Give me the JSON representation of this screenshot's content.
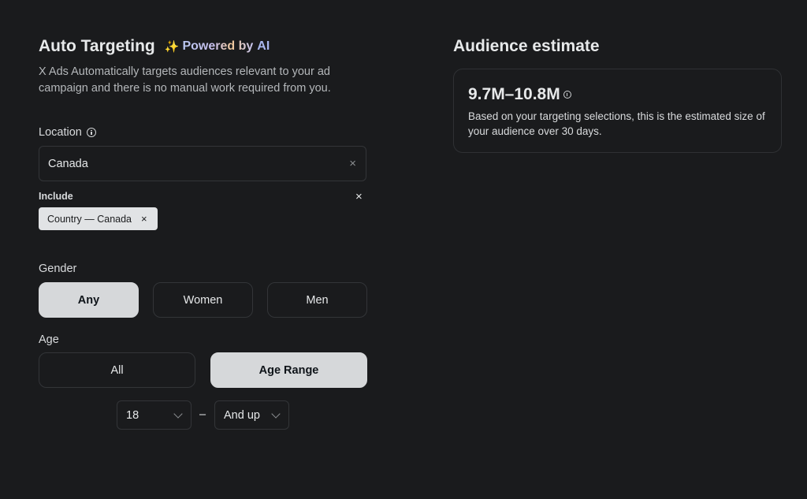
{
  "auto_targeting": {
    "title": "Auto Targeting",
    "powered_sparkle": "✨",
    "powered_by": "Powered by",
    "powered_ai": "AI",
    "description": "X Ads Automatically targets audiences relevant to your ad campaign and there is no manual work required from you."
  },
  "location": {
    "label": "Location",
    "input_value": "Canada",
    "clear_icon": "×",
    "include_label": "Include",
    "include_close": "×",
    "chips": [
      {
        "label": "Country — Canada",
        "remove": "×"
      }
    ]
  },
  "gender": {
    "label": "Gender",
    "options": [
      "Any",
      "Women",
      "Men"
    ],
    "selected": "Any"
  },
  "age": {
    "label": "Age",
    "options": [
      "All",
      "Age Range"
    ],
    "selected": "Age Range",
    "from": "18",
    "separator": "–",
    "to": "And up"
  },
  "audience": {
    "title": "Audience estimate",
    "range": "9.7M–10.8M",
    "description": "Based on your targeting selections, this is the estimated size of your audience over 30 days."
  },
  "colors": {
    "background": "#1a1b1d",
    "selected_button": "#d6d8da",
    "border": "#333538"
  }
}
